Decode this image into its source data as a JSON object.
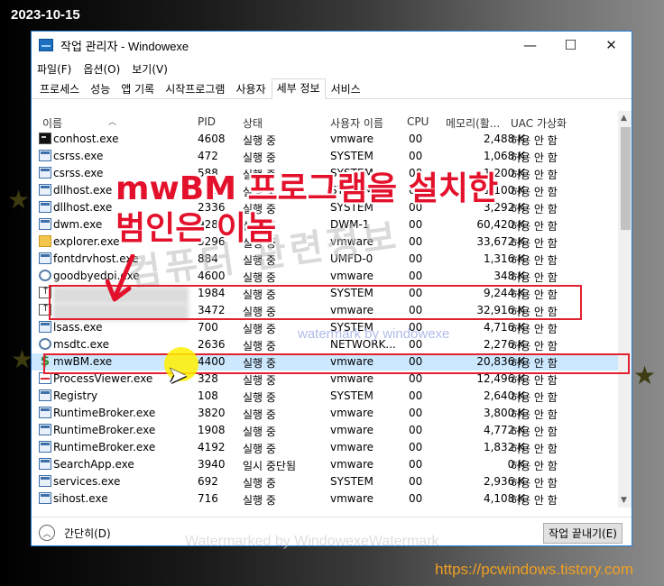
{
  "date_stamp": "2023-10-15",
  "site_url": "https://pcwindows.tistory.com",
  "window": {
    "title": "작업 관리자  - Windowexe",
    "minimize": "—",
    "maximize": "☐",
    "close": "✕"
  },
  "menu": [
    "파일(F)",
    "옵션(O)",
    "보기(V)"
  ],
  "tabs": [
    "프로세스",
    "성능",
    "앱 기록",
    "시작프로그램",
    "사용자",
    "세부 정보",
    "서비스"
  ],
  "active_tab": "세부 정보",
  "columns": [
    "이름",
    "PID",
    "상태",
    "사용자 이름",
    "CPU",
    "메모리(활...",
    "UAC 가상화"
  ],
  "rows": [
    {
      "icon": "cmd",
      "name": "conhost.exe",
      "pid": "4608",
      "status": "실행 중",
      "user": "vmware",
      "cpu": "00",
      "mem": "2,488 K",
      "uac": "허용 안 함"
    },
    {
      "icon": "app",
      "name": "csrss.exe",
      "pid": "472",
      "status": "실행 중",
      "user": "SYSTEM",
      "cpu": "00",
      "mem": "1,068 K",
      "uac": "허용 안 함"
    },
    {
      "icon": "app",
      "name": "csrss.exe",
      "pid": "588",
      "status": "실행 중",
      "user": "SYSTEM",
      "cpu": "00",
      "mem": "1,200 K",
      "uac": "허용 안 함"
    },
    {
      "icon": "app",
      "name": "dllhost.exe",
      "pid": "1084",
      "status": "실행 중",
      "user": "SYSTEM",
      "cpu": "00",
      "mem": "1,100 K",
      "uac": "허용 안 함"
    },
    {
      "icon": "app",
      "name": "dllhost.exe",
      "pid": "2336",
      "status": "실행 중",
      "user": "SYSTEM",
      "cpu": "00",
      "mem": "3,292 K",
      "uac": "허용 안 함"
    },
    {
      "icon": "app",
      "name": "dwm.exe",
      "pid": "928",
      "status": "실행 중",
      "user": "DWM-1",
      "cpu": "00",
      "mem": "60,420 K",
      "uac": "허용 안 함"
    },
    {
      "icon": "folder",
      "name": "explorer.exe",
      "pid": "5296",
      "status": "실행 중",
      "user": "vmware",
      "cpu": "00",
      "mem": "33,672 K",
      "uac": "허용 안 함"
    },
    {
      "icon": "app",
      "name": "fontdrvhost.exe",
      "pid": "884",
      "status": "실행 중",
      "user": "UMFD-0",
      "cpu": "00",
      "mem": "1,316 K",
      "uac": "허용 안 함"
    },
    {
      "icon": "gear",
      "name": "goodbyedpi.exe",
      "pid": "4600",
      "status": "실행 중",
      "user": "vmware",
      "cpu": "00",
      "mem": "348 K",
      "uac": "허용 안 함"
    },
    {
      "icon": "up",
      "name": "",
      "pid": "1984",
      "status": "실행 중",
      "user": "SYSTEM",
      "cpu": "00",
      "mem": "9,244 K",
      "uac": "허용 안 함",
      "blurred": true
    },
    {
      "icon": "up",
      "name": "",
      "pid": "3472",
      "status": "실행 중",
      "user": "vmware",
      "cpu": "00",
      "mem": "32,916 K",
      "uac": "허용 안 함",
      "blurred": true
    },
    {
      "icon": "app",
      "name": "lsass.exe",
      "pid": "700",
      "status": "실행 중",
      "user": "SYSTEM",
      "cpu": "00",
      "mem": "4,716 K",
      "uac": "허용 안 함"
    },
    {
      "icon": "gear",
      "name": "msdtc.exe",
      "pid": "2636",
      "status": "실행 중",
      "user": "NETWORK...",
      "cpu": "00",
      "mem": "2,276 K",
      "uac": "허용 안 함"
    },
    {
      "icon": "dollar",
      "name": "mwBM.exe",
      "pid": "4400",
      "status": "실행 중",
      "user": "vmware",
      "cpu": "00",
      "mem": "20,836 K",
      "uac": "허용 안 함",
      "selected": true
    },
    {
      "icon": "pv",
      "name": "ProcessViewer.exe",
      "pid": "328",
      "status": "실행 중",
      "user": "vmware",
      "cpu": "00",
      "mem": "12,496 K",
      "uac": "허용 안 함"
    },
    {
      "icon": "app",
      "name": "Registry",
      "pid": "108",
      "status": "실행 중",
      "user": "SYSTEM",
      "cpu": "00",
      "mem": "2,640 K",
      "uac": "허용 안 함"
    },
    {
      "icon": "app",
      "name": "RuntimeBroker.exe",
      "pid": "3820",
      "status": "실행 중",
      "user": "vmware",
      "cpu": "00",
      "mem": "3,800 K",
      "uac": "허용 안 함"
    },
    {
      "icon": "app",
      "name": "RuntimeBroker.exe",
      "pid": "1908",
      "status": "실행 중",
      "user": "vmware",
      "cpu": "00",
      "mem": "4,772 K",
      "uac": "허용 안 함"
    },
    {
      "icon": "app",
      "name": "RuntimeBroker.exe",
      "pid": "4192",
      "status": "실행 중",
      "user": "vmware",
      "cpu": "00",
      "mem": "1,832 K",
      "uac": "허용 안 함"
    },
    {
      "icon": "app",
      "name": "SearchApp.exe",
      "pid": "3940",
      "status": "일시 중단됨",
      "user": "vmware",
      "cpu": "00",
      "mem": "0 K",
      "uac": "허용 안 함"
    },
    {
      "icon": "app",
      "name": "services.exe",
      "pid": "692",
      "status": "실행 중",
      "user": "SYSTEM",
      "cpu": "00",
      "mem": "2,936 K",
      "uac": "허용 안 함"
    },
    {
      "icon": "app",
      "name": "sihost.exe",
      "pid": "716",
      "status": "실행 중",
      "user": "vmware",
      "cpu": "00",
      "mem": "4,108 K",
      "uac": "허용 안 함"
    }
  ],
  "footer": {
    "fewer_details": "간단히(D)",
    "end_task": "작업 끝내기(E)"
  },
  "annotation": {
    "line1": "mwBM 프로그램을 설치한",
    "line2": "범인은 이놈"
  },
  "watermarks": {
    "bottom": "Watermarked by WindowexeWatermark",
    "middle": "watermark by windowexe",
    "big": "컴퓨터 관련정보"
  },
  "colors": {
    "highlight_red": "#e32030",
    "selection_blue": "#cce8ff",
    "site_orange": "#f0a020"
  }
}
